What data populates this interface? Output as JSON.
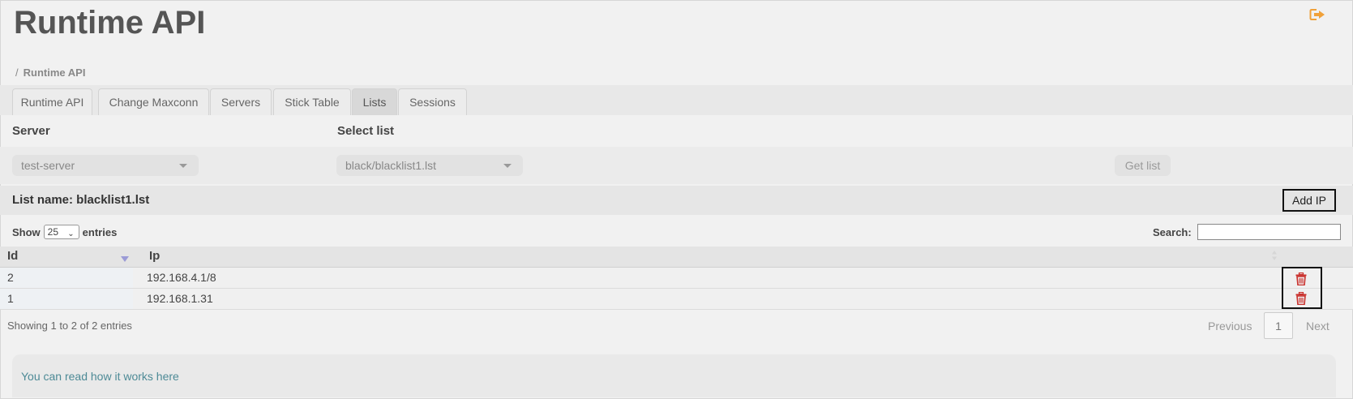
{
  "header": {
    "title": "Runtime API",
    "logout_icon": "sign-out-icon",
    "accent_color": "#f0a13a"
  },
  "breadcrumb": {
    "separator": "/",
    "current": "Runtime API"
  },
  "tabs": [
    {
      "label": "Runtime API",
      "active": false
    },
    {
      "label": "Change Maxconn",
      "active": false
    },
    {
      "label": "Servers",
      "active": false
    },
    {
      "label": "Stick Table",
      "active": false
    },
    {
      "label": "Lists",
      "active": true
    },
    {
      "label": "Sessions",
      "active": false
    }
  ],
  "form": {
    "server_label": "Server",
    "server_value": "test-server",
    "list_label": "Select list",
    "list_value": "black/blacklist1.lst",
    "get_list_label": "Get list"
  },
  "list": {
    "name_text": "List name: blacklist1.lst",
    "add_ip_label": "Add IP"
  },
  "table_controls": {
    "show_label": "Show",
    "entries_value": "25",
    "entries_label": "entries",
    "search_label": "Search:",
    "search_value": ""
  },
  "table": {
    "columns": [
      "Id",
      "Ip"
    ],
    "sort": {
      "column": "Id",
      "direction": "desc"
    },
    "rows": [
      {
        "id": "2",
        "ip": "192.168.4.1/8"
      },
      {
        "id": "1",
        "ip": "192.168.1.31"
      }
    ],
    "delete_icon": "trash-icon",
    "delete_color": "#c9302c"
  },
  "footer": {
    "info": "Showing 1 to 2 of 2 entries",
    "previous": "Previous",
    "page": "1",
    "next": "Next"
  },
  "note": {
    "prefix": "You can read how it works ",
    "link": "here"
  }
}
